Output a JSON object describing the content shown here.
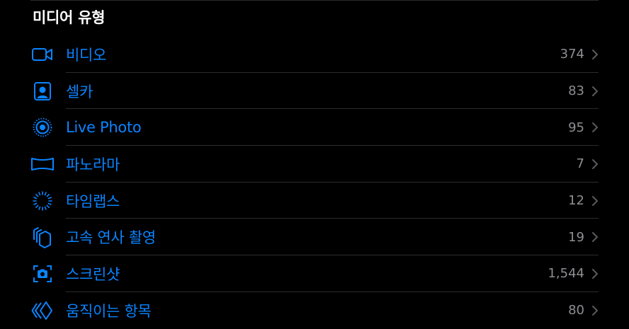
{
  "section": {
    "title": "미디어 유형"
  },
  "colors": {
    "background": "#000000",
    "accent": "#0a84ff",
    "secondary_text": "#8e8e93",
    "separator": "#2c2c2e"
  },
  "media_types": [
    {
      "label": "비디오",
      "count": "374",
      "icon": "video-camera-icon"
    },
    {
      "label": "셀카",
      "count": "83",
      "icon": "selfie-portrait-icon"
    },
    {
      "label": "Live Photo",
      "count": "95",
      "icon": "live-photo-icon"
    },
    {
      "label": "파노라마",
      "count": "7",
      "icon": "panorama-icon"
    },
    {
      "label": "타임랩스",
      "count": "12",
      "icon": "timelapse-icon"
    },
    {
      "label": "고속 연사 촬영",
      "count": "19",
      "icon": "burst-icon"
    },
    {
      "label": "스크린샷",
      "count": "1,544",
      "icon": "screenshot-icon"
    },
    {
      "label": "움직이는 항목",
      "count": "80",
      "icon": "animated-icon"
    }
  ]
}
